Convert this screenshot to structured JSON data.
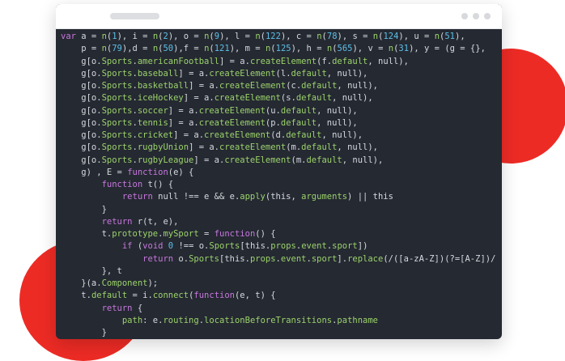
{
  "colors": {
    "background": "#ffffff",
    "accent_blob": "#ed2b25",
    "editor_bg": "#252932",
    "titlebar_bg": "#ffffff",
    "keyword": "#c678dd",
    "number": "#5bc0e8",
    "identifier": "#9bd36b",
    "variable": "#e5c07b",
    "plain": "#d6d9de"
  },
  "window": {
    "controls": [
      "window-dot-icon",
      "window-dot-icon",
      "window-dot-icon"
    ]
  },
  "code_lines": [
    [
      [
        "k",
        "var"
      ],
      [
        "t",
        " a = "
      ],
      [
        "g",
        "n"
      ],
      [
        "t",
        "("
      ],
      [
        "n",
        "1"
      ],
      [
        "t",
        "), i = "
      ],
      [
        "g",
        "n"
      ],
      [
        "t",
        "("
      ],
      [
        "n",
        "2"
      ],
      [
        "t",
        "), o = "
      ],
      [
        "g",
        "n"
      ],
      [
        "t",
        "("
      ],
      [
        "n",
        "9"
      ],
      [
        "t",
        "), l = "
      ],
      [
        "g",
        "n"
      ],
      [
        "t",
        "("
      ],
      [
        "n",
        "122"
      ],
      [
        "t",
        "), c = "
      ],
      [
        "g",
        "n"
      ],
      [
        "t",
        "("
      ],
      [
        "n",
        "78"
      ],
      [
        "t",
        "), s = "
      ],
      [
        "g",
        "n"
      ],
      [
        "t",
        "("
      ],
      [
        "n",
        "124"
      ],
      [
        "t",
        "), u = "
      ],
      [
        "g",
        "n"
      ],
      [
        "t",
        "("
      ],
      [
        "n",
        "51"
      ],
      [
        "t",
        "),"
      ]
    ],
    [
      [
        "t",
        "    p = "
      ],
      [
        "g",
        "n"
      ],
      [
        "t",
        "("
      ],
      [
        "n",
        "79"
      ],
      [
        "t",
        "),d = "
      ],
      [
        "g",
        "n"
      ],
      [
        "t",
        "("
      ],
      [
        "n",
        "50"
      ],
      [
        "t",
        "),f = "
      ],
      [
        "g",
        "n"
      ],
      [
        "t",
        "("
      ],
      [
        "n",
        "121"
      ],
      [
        "t",
        "), m = "
      ],
      [
        "g",
        "n"
      ],
      [
        "t",
        "("
      ],
      [
        "n",
        "125"
      ],
      [
        "t",
        "), h = "
      ],
      [
        "g",
        "n"
      ],
      [
        "t",
        "("
      ],
      [
        "n",
        "565"
      ],
      [
        "t",
        "), v = "
      ],
      [
        "g",
        "n"
      ],
      [
        "t",
        "("
      ],
      [
        "n",
        "31"
      ],
      [
        "t",
        "), y = (g = {},"
      ]
    ],
    [
      [
        "t",
        "    g[o."
      ],
      [
        "g",
        "Sports"
      ],
      [
        "t",
        "."
      ],
      [
        "g",
        "americanFootball"
      ],
      [
        "t",
        "] = a."
      ],
      [
        "g",
        "createElement"
      ],
      [
        "t",
        "(f."
      ],
      [
        "g",
        "default"
      ],
      [
        "t",
        ", null),"
      ]
    ],
    [
      [
        "t",
        "    g[o."
      ],
      [
        "g",
        "Sports"
      ],
      [
        "t",
        "."
      ],
      [
        "g",
        "baseball"
      ],
      [
        "t",
        "] = a."
      ],
      [
        "g",
        "createElement"
      ],
      [
        "t",
        "(l."
      ],
      [
        "g",
        "default"
      ],
      [
        "t",
        ", null),"
      ]
    ],
    [
      [
        "t",
        "    g[o."
      ],
      [
        "g",
        "Sports"
      ],
      [
        "t",
        "."
      ],
      [
        "g",
        "basketball"
      ],
      [
        "t",
        "] = a."
      ],
      [
        "g",
        "createElement"
      ],
      [
        "t",
        "(c."
      ],
      [
        "g",
        "default"
      ],
      [
        "t",
        ", null),"
      ]
    ],
    [
      [
        "t",
        "    g[o."
      ],
      [
        "g",
        "Sports"
      ],
      [
        "t",
        "."
      ],
      [
        "g",
        "iceHockey"
      ],
      [
        "t",
        "] = a."
      ],
      [
        "g",
        "createElement"
      ],
      [
        "t",
        "(s."
      ],
      [
        "g",
        "default"
      ],
      [
        "t",
        ", null),"
      ]
    ],
    [
      [
        "t",
        "    g[o."
      ],
      [
        "g",
        "Sports"
      ],
      [
        "t",
        "."
      ],
      [
        "g",
        "soccer"
      ],
      [
        "t",
        "] = a."
      ],
      [
        "g",
        "createElement"
      ],
      [
        "t",
        "(u."
      ],
      [
        "g",
        "default"
      ],
      [
        "t",
        ", null),"
      ]
    ],
    [
      [
        "t",
        "    g[o."
      ],
      [
        "g",
        "Sports"
      ],
      [
        "t",
        "."
      ],
      [
        "g",
        "tennis"
      ],
      [
        "t",
        "] = a."
      ],
      [
        "g",
        "createElement"
      ],
      [
        "t",
        "(p."
      ],
      [
        "g",
        "default"
      ],
      [
        "t",
        ", null),"
      ]
    ],
    [
      [
        "t",
        "    g[o."
      ],
      [
        "g",
        "Sports"
      ],
      [
        "t",
        "."
      ],
      [
        "g",
        "cricket"
      ],
      [
        "t",
        "] = a."
      ],
      [
        "g",
        "createElement"
      ],
      [
        "t",
        "(d."
      ],
      [
        "g",
        "default"
      ],
      [
        "t",
        ", null),"
      ]
    ],
    [
      [
        "t",
        "    g[o."
      ],
      [
        "g",
        "Sports"
      ],
      [
        "t",
        "."
      ],
      [
        "g",
        "rugbyUnion"
      ],
      [
        "t",
        "] = a."
      ],
      [
        "g",
        "createElement"
      ],
      [
        "t",
        "(m."
      ],
      [
        "g",
        "default"
      ],
      [
        "t",
        ", null),"
      ]
    ],
    [
      [
        "t",
        "    g[o."
      ],
      [
        "g",
        "Sports"
      ],
      [
        "t",
        "."
      ],
      [
        "g",
        "rugbyLeague"
      ],
      [
        "t",
        "] = a."
      ],
      [
        "g",
        "createElement"
      ],
      [
        "t",
        "(m."
      ],
      [
        "g",
        "default"
      ],
      [
        "t",
        ", null),"
      ]
    ],
    [
      [
        "t",
        "    g) , E = "
      ],
      [
        "k",
        "function"
      ],
      [
        "t",
        "(e) {"
      ]
    ],
    [
      [
        "t",
        "        "
      ],
      [
        "k",
        "function"
      ],
      [
        "t",
        " t() {"
      ]
    ],
    [
      [
        "t",
        "            "
      ],
      [
        "k",
        "return"
      ],
      [
        "t",
        " null !== e && e."
      ],
      [
        "g",
        "apply"
      ],
      [
        "t",
        "(this, "
      ],
      [
        "g",
        "arguments"
      ],
      [
        "t",
        ") || this"
      ]
    ],
    [
      [
        "t",
        "        }"
      ]
    ],
    [
      [
        "t",
        "        "
      ],
      [
        "k",
        "return"
      ],
      [
        "t",
        " r(t, e),"
      ]
    ],
    [
      [
        "t",
        "        t."
      ],
      [
        "g",
        "prototype"
      ],
      [
        "t",
        "."
      ],
      [
        "g",
        "mySport"
      ],
      [
        "t",
        " = "
      ],
      [
        "k",
        "function"
      ],
      [
        "t",
        "() {"
      ]
    ],
    [
      [
        "t",
        "            "
      ],
      [
        "k",
        "if"
      ],
      [
        "t",
        " ("
      ],
      [
        "k",
        "void"
      ],
      [
        "t",
        " "
      ],
      [
        "n",
        "0"
      ],
      [
        "t",
        " !== o."
      ],
      [
        "g",
        "Sports"
      ],
      [
        "t",
        "[this."
      ],
      [
        "g",
        "props"
      ],
      [
        "t",
        "."
      ],
      [
        "g",
        "event"
      ],
      [
        "t",
        "."
      ],
      [
        "g",
        "sport"
      ],
      [
        "t",
        "])"
      ]
    ],
    [
      [
        "t",
        "                "
      ],
      [
        "k",
        "return"
      ],
      [
        "t",
        " o."
      ],
      [
        "g",
        "Sports"
      ],
      [
        "t",
        "[this."
      ],
      [
        "g",
        "props"
      ],
      [
        "t",
        "."
      ],
      [
        "g",
        "event"
      ],
      [
        "t",
        "."
      ],
      [
        "g",
        "sport"
      ],
      [
        "t",
        "]."
      ],
      [
        "g",
        "replace"
      ],
      [
        "t",
        "(/([a-zA-Z])(?=[A-Z])/"
      ]
    ],
    [
      [
        "t",
        "        }, t"
      ]
    ],
    [
      [
        "t",
        "    }(a."
      ],
      [
        "g",
        "Component"
      ],
      [
        "t",
        ");"
      ]
    ],
    [
      [
        "t",
        "    t."
      ],
      [
        "g",
        "default"
      ],
      [
        "t",
        " = i."
      ],
      [
        "g",
        "connect"
      ],
      [
        "t",
        "("
      ],
      [
        "k",
        "function"
      ],
      [
        "t",
        "(e, t) {"
      ]
    ],
    [
      [
        "t",
        "        "
      ],
      [
        "k",
        "return"
      ],
      [
        "t",
        " {"
      ]
    ],
    [
      [
        "t",
        "            "
      ],
      [
        "g",
        "path"
      ],
      [
        "t",
        ": e."
      ],
      [
        "g",
        "routing"
      ],
      [
        "t",
        "."
      ],
      [
        "g",
        "locationBeforeTransitions"
      ],
      [
        "t",
        "."
      ],
      [
        "g",
        "pathname"
      ]
    ],
    [
      [
        "t",
        "        }"
      ]
    ]
  ]
}
